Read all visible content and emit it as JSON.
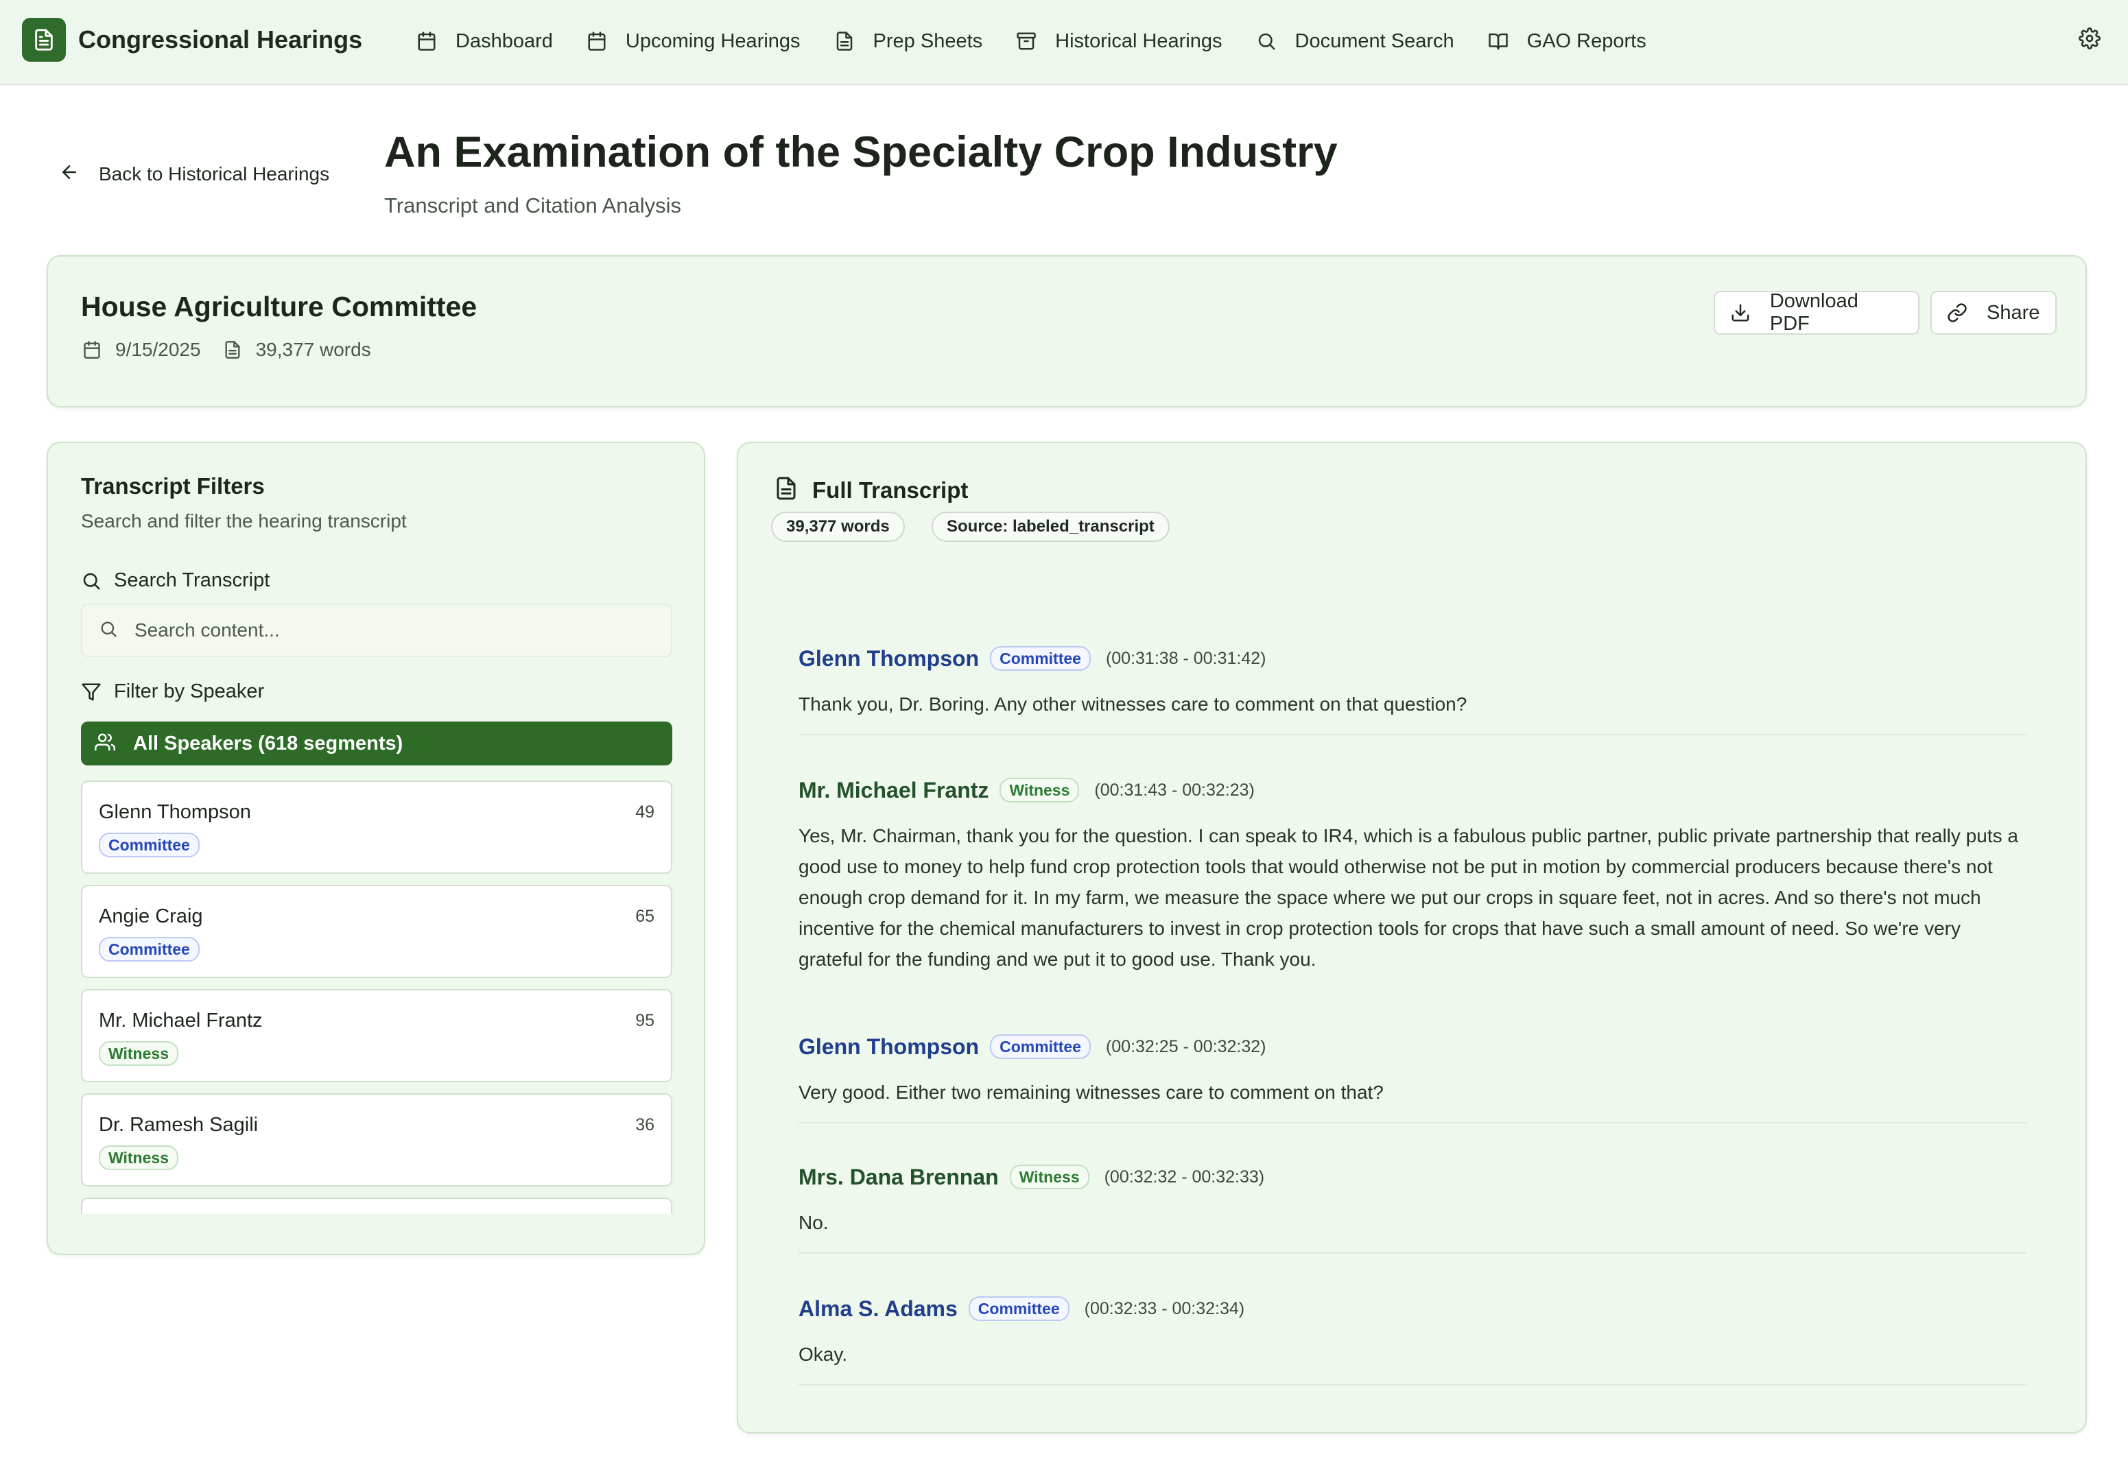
{
  "app": {
    "title": "Congressional Hearings",
    "brand_color": "#2f6b2a"
  },
  "nav": [
    {
      "label": "Dashboard",
      "icon": "calendar-icon"
    },
    {
      "label": "Upcoming Hearings",
      "icon": "calendar-icon"
    },
    {
      "label": "Prep Sheets",
      "icon": "document-icon"
    },
    {
      "label": "Historical Hearings",
      "icon": "archive-icon"
    },
    {
      "label": "Document Search",
      "icon": "search-icon"
    },
    {
      "label": "GAO Reports",
      "icon": "book-icon"
    }
  ],
  "header": {
    "back_label": "Back to Historical Hearings",
    "title": "An Examination of the Specialty Crop Industry",
    "subtitle": "Transcript and Citation Analysis"
  },
  "hearing": {
    "committee": "House Agriculture Committee",
    "date": "9/15/2025",
    "word_count": "39,377 words",
    "download_label": "Download PDF",
    "share_label": "Share"
  },
  "filters": {
    "title": "Transcript Filters",
    "subtitle": "Search and filter the hearing transcript",
    "search_label": "Search Transcript",
    "search_placeholder": "Search content...",
    "search_value": "",
    "speaker_label": "Filter by Speaker",
    "all_speakers_label": "All Speakers (618 segments)",
    "speakers": [
      {
        "name": "Glenn Thompson",
        "role": "Committee",
        "count": "49"
      },
      {
        "name": "Angie Craig",
        "role": "Committee",
        "count": "65"
      },
      {
        "name": "Mr. Michael Frantz",
        "role": "Witness",
        "count": "95"
      },
      {
        "name": "Dr. Ramesh Sagili",
        "role": "Witness",
        "count": "36"
      }
    ]
  },
  "transcript": {
    "title": "Full Transcript",
    "word_pill": "39,377 words",
    "source_pill": "Source: labeled_transcript",
    "segments": [
      {
        "speaker": "Glenn Thompson",
        "role": "Committee",
        "time": "(00:31:38 - 00:31:42)",
        "text": "Thank you, Dr. Boring. Any other witnesses care to comment on that question?"
      },
      {
        "speaker": "Mr. Michael Frantz",
        "role": "Witness",
        "time": "(00:31:43 - 00:32:23)",
        "text": "Yes, Mr. Chairman, thank you for the question. I can speak to IR4, which is a fabulous public partner, public private partnership that really puts a good use to money to help fund crop protection tools that would otherwise not be put in motion by commercial producers because there's not enough crop demand for it. In my farm, we measure the space where we put our crops in square feet, not in acres. And so there's not much incentive for the chemical manufacturers to invest in crop protection tools for crops that have such a small amount of need. So we're very grateful for the funding and we put it to good use. Thank you."
      },
      {
        "speaker": "Glenn Thompson",
        "role": "Committee",
        "time": "(00:32:25 - 00:32:32)",
        "text": "Very good. Either two remaining witnesses care to comment on that?"
      },
      {
        "speaker": "Mrs. Dana Brennan",
        "role": "Witness",
        "time": "(00:32:32 - 00:32:33)",
        "text": "No."
      },
      {
        "speaker": "Alma S. Adams",
        "role": "Committee",
        "time": "(00:32:33 - 00:32:34)",
        "text": "Okay."
      }
    ]
  }
}
